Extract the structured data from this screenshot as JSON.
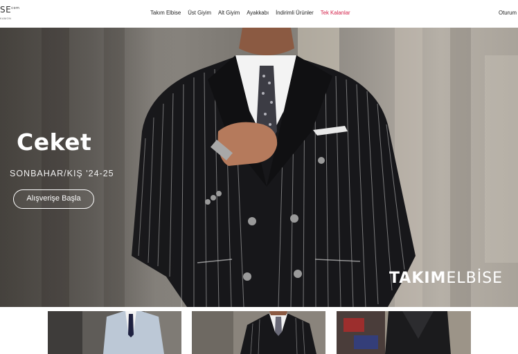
{
  "header": {
    "logo_text": "SE",
    "logo_superscript": "com",
    "logo_subtext": "KAMON",
    "nav": [
      {
        "label": "Takım Elbise"
      },
      {
        "label": "Üst Giyim"
      },
      {
        "label": "Alt Giyim"
      },
      {
        "label": "Ayakkabı"
      },
      {
        "label": "İndirimli Ürünler"
      },
      {
        "label": "Tek Kalanlar"
      }
    ],
    "login_label": "Oturum"
  },
  "hero": {
    "title": "Ceket",
    "subtitle": "SONBAHAR/KIŞ '24-25",
    "cta_label": "Alışverişe Başla",
    "brand_bold": "TAKIM",
    "brand_light": "ELBİSE"
  },
  "thumbnails": [
    {
      "icon": "light-gray-suit-photo"
    },
    {
      "icon": "pinstripe-suit-photo"
    },
    {
      "icon": "dark-suit-photo"
    }
  ],
  "colors": {
    "accent_red": "#d4224a",
    "text_dark": "#222222",
    "white": "#ffffff"
  }
}
